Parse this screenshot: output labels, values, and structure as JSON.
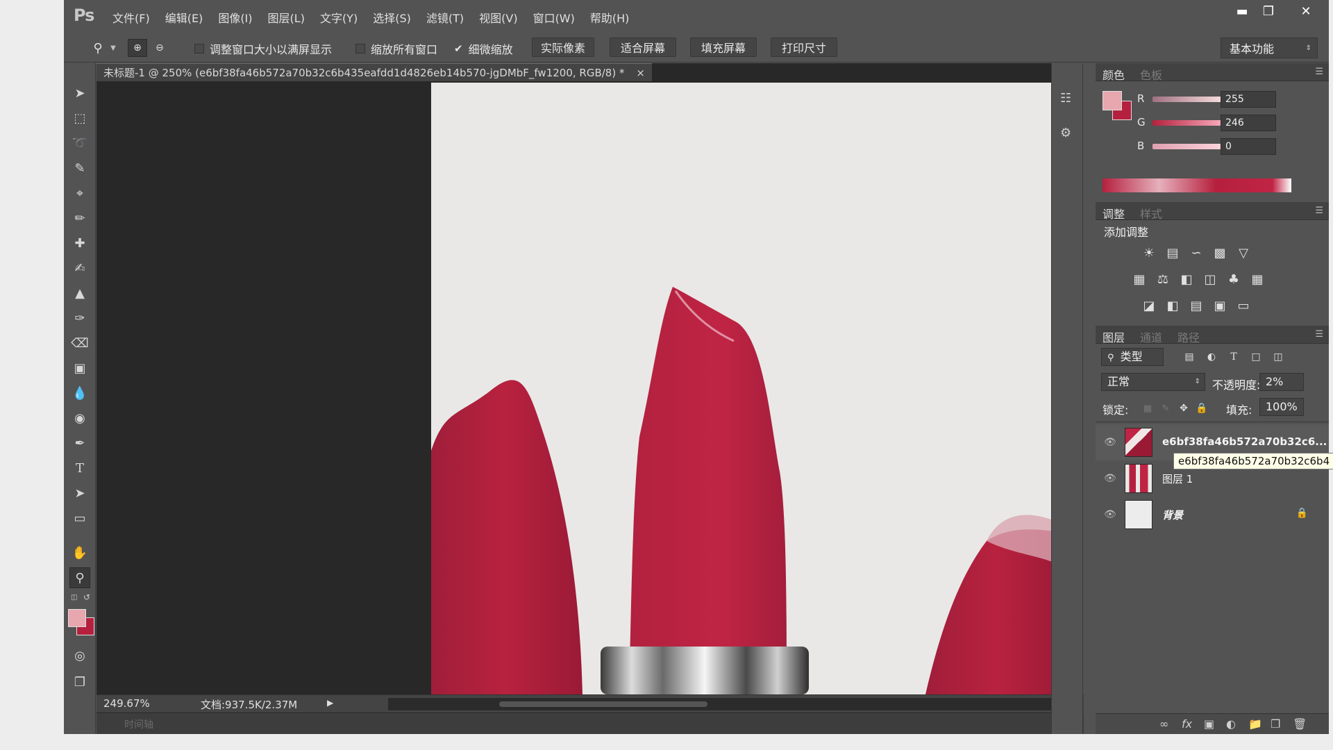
{
  "app": {
    "logo": "Ps"
  },
  "menu": [
    "文件(F)",
    "编辑(E)",
    "图像(I)",
    "图层(L)",
    "文字(Y)",
    "选择(S)",
    "滤镜(T)",
    "视图(V)",
    "窗口(W)",
    "帮助(H)"
  ],
  "window_controls": {
    "minimize": "▬",
    "restore": "❐",
    "close": "✕"
  },
  "options": {
    "resize_windows": "调整窗口大小以满屏显示",
    "zoom_all": "缩放所有窗口",
    "scrubby_zoom": "细微缩放",
    "actual_pixels": "实际像素",
    "fit_screen": "适合屏幕",
    "fill_screen": "填充屏幕",
    "print_size": "打印尺寸",
    "workspace": "基本功能"
  },
  "document": {
    "tab_title": "未标题-1 @ 250% (e6bf38fa46b572a70b32c6b435eafdd1d4826eb14b570-jgDMbF_fw1200, RGB/8) *",
    "close": "×"
  },
  "status": {
    "zoom": "249.67%",
    "doc_info": "文档:937.5K/2.37M",
    "timeline": "时间轴"
  },
  "color_panel": {
    "tab_active": "颜色",
    "tab_inactive": "色板",
    "r_label": "R",
    "g_label": "G",
    "b_label": "B",
    "r_value": "255",
    "g_value": "246",
    "b_value": "0",
    "fg_color": "#e8a6ae",
    "bg_color": "#b5203e"
  },
  "adjust_panel": {
    "tab_active": "调整",
    "tab_inactive": "样式",
    "title": "添加调整"
  },
  "layers_panel": {
    "tab_active": "图层",
    "tab_inactive_1": "通道",
    "tab_inactive_2": "路径",
    "filter_kind": "类型",
    "blend_mode": "正常",
    "opacity_label": "不透明度:",
    "opacity_value": "2%",
    "lock_label": "锁定:",
    "fill_label": "填充:",
    "fill_value": "100%",
    "layers": [
      {
        "name": "e6bf38fa46b572a70b32c6..."
      },
      {
        "name": "图层 1"
      },
      {
        "name": "背景"
      }
    ],
    "tooltip": "e6bf38fa46b572a70b32c6b4"
  }
}
